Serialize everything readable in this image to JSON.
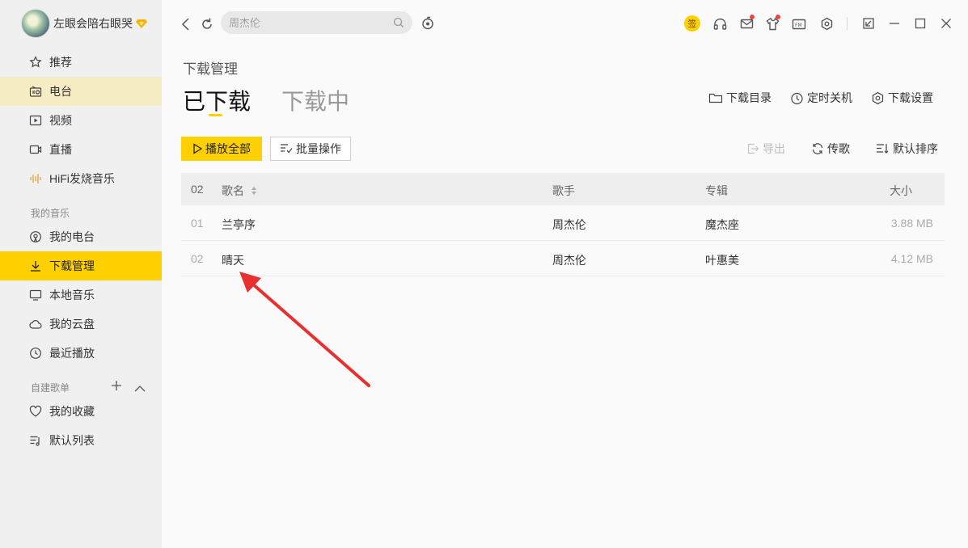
{
  "colors": {
    "accent": "#ffd000",
    "highlight": "#f6ecc4",
    "annotation_arrow": "#e83030"
  },
  "profile": {
    "username": "左眼会陪右眼哭",
    "vip_icon": "diamond-icon"
  },
  "sidebar": {
    "items": [
      {
        "label": "推荐",
        "icon": "star-icon"
      },
      {
        "label": "电台",
        "icon": "radio-icon"
      },
      {
        "label": "视频",
        "icon": "video-icon"
      },
      {
        "label": "直播",
        "icon": "live-camera-icon"
      },
      {
        "label": "HiFi发烧音乐",
        "icon": "sound-wave-icon"
      }
    ],
    "my_music_title": "我的音乐",
    "my_music_items": [
      {
        "label": "我的电台",
        "icon": "podcast-icon"
      },
      {
        "label": "下载管理",
        "icon": "download-icon"
      },
      {
        "label": "本地音乐",
        "icon": "monitor-icon"
      },
      {
        "label": "我的云盘",
        "icon": "cloud-icon"
      },
      {
        "label": "最近播放",
        "icon": "clock-icon"
      }
    ],
    "playlist_title": "自建歌单",
    "playlist_items": [
      {
        "label": "我的收藏",
        "icon": "heart-icon"
      },
      {
        "label": "默认列表",
        "icon": "playlist-icon"
      }
    ]
  },
  "topbar": {
    "search_placeholder": "周杰伦",
    "sign_label": "签"
  },
  "main": {
    "page_title": "下载管理",
    "tabs": [
      {
        "label": "已下载"
      },
      {
        "label": "下载中"
      }
    ],
    "actions": {
      "folder": "下载目录",
      "timer": "定时关机",
      "settings": "下载设置"
    },
    "play_all": "播放全部",
    "batch": "批量操作",
    "export": "导出",
    "transfer": "传歌",
    "sort": "默认排序"
  },
  "table": {
    "header": {
      "count": "02",
      "title": "歌名",
      "artist": "歌手",
      "album": "专辑",
      "size": "大小"
    },
    "rows": [
      {
        "num": "01",
        "title": "兰亭序",
        "artist": "周杰伦",
        "album": "魔杰座",
        "size": "3.88 MB"
      },
      {
        "num": "02",
        "title": "晴天",
        "artist": "周杰伦",
        "album": "叶惠美",
        "size": "4.12 MB"
      }
    ]
  }
}
